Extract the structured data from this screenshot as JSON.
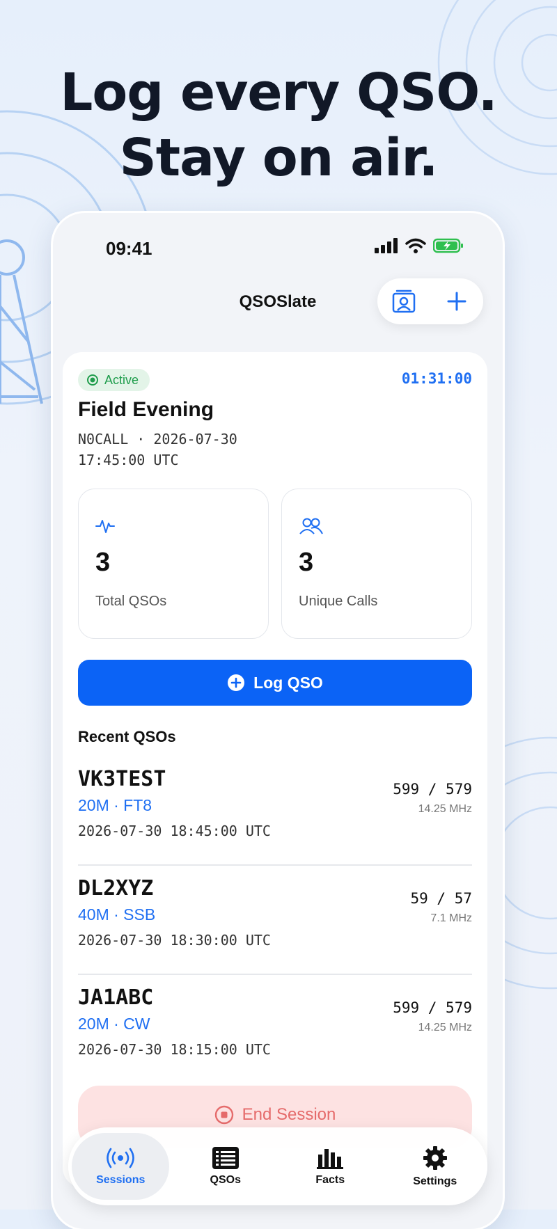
{
  "headline": {
    "line1": "Log every QSO.",
    "line2": "Stay on air."
  },
  "status_bar": {
    "time": "09:41"
  },
  "app": {
    "title": "QSOSlate"
  },
  "session": {
    "status": "Active",
    "timer": "01:31:00",
    "title": "Field Evening",
    "meta_line1": "N0CALL · 2026-07-30",
    "meta_line2": "17:45:00 UTC"
  },
  "stats": [
    {
      "value": "3",
      "label": "Total QSOs",
      "icon": "activity-pulse-icon"
    },
    {
      "value": "3",
      "label": "Unique Calls",
      "icon": "users-icon"
    }
  ],
  "log_button": {
    "label": "Log QSO"
  },
  "recent": {
    "title": "Recent QSOs",
    "items": [
      {
        "call": "VK3TEST",
        "band_mode": "20M · FT8",
        "timestamp": "2026-07-30 18:45:00 UTC",
        "rst": "599 / 579",
        "freq": "14.25 MHz"
      },
      {
        "call": "DL2XYZ",
        "band_mode": "40M · SSB",
        "timestamp": "2026-07-30 18:30:00 UTC",
        "rst": "59 / 57",
        "freq": "7.1 MHz"
      },
      {
        "call": "JA1ABC",
        "band_mode": "20M · CW",
        "timestamp": "2026-07-30 18:15:00 UTC",
        "rst": "599 / 579",
        "freq": "14.25 MHz"
      }
    ]
  },
  "end_button": {
    "label": "End Session"
  },
  "tabs": [
    {
      "label": "Sessions",
      "icon": "broadcast-icon",
      "active": true
    },
    {
      "label": "QSOs",
      "icon": "list-icon",
      "active": false
    },
    {
      "label": "Facts",
      "icon": "bar-chart-icon",
      "active": false
    },
    {
      "label": "Settings",
      "icon": "gear-icon",
      "active": false
    }
  ],
  "colors": {
    "accent": "#0b63f6",
    "active_green": "#1f9d4c",
    "danger": "#e56b6b",
    "link_blue": "#1f6ff2"
  }
}
